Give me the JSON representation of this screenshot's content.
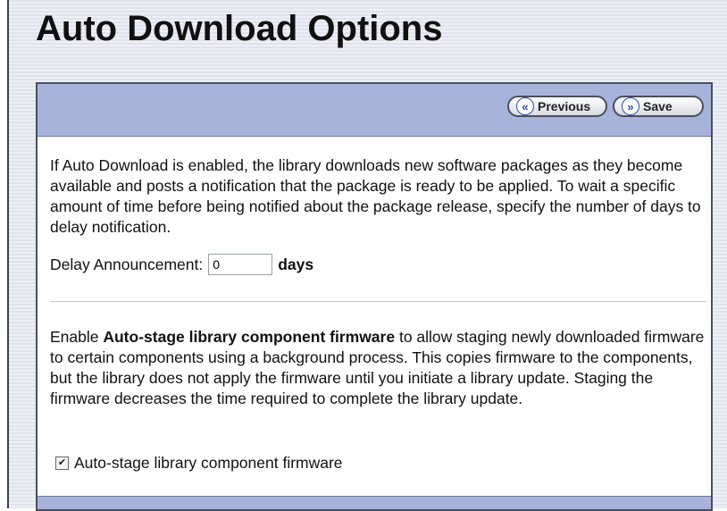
{
  "page": {
    "title": "Auto Download Options"
  },
  "toolbar": {
    "previous_icon": "«",
    "previous_label": "Previous",
    "save_icon": "»",
    "save_label": "Save"
  },
  "auto_download": {
    "description": "If Auto Download is enabled, the library downloads new software packages as they become available and posts a notification that the package is ready to be applied. To wait a specific amount of time before being notified about the package release, specify the number of days to delay notification.",
    "delay_label": "Delay Announcement:",
    "delay_value": "0",
    "delay_unit": "days"
  },
  "auto_stage": {
    "intro": "Enable ",
    "bold_term": "Auto-stage library component firmware",
    "description": " to allow staging newly downloaded firmware to certain components using a background process. This copies firmware to the components, but the library does not apply the firmware until you initiate a library update. Staging the firmware decreases the time required to complete the library update.",
    "checkbox_label": "Auto-stage library component firmware",
    "checkbox_checked": true
  },
  "icons": {
    "previous": "double-chevron-left-icon",
    "save": "double-chevron-right-icon",
    "checkmark": "checkmark-icon"
  }
}
